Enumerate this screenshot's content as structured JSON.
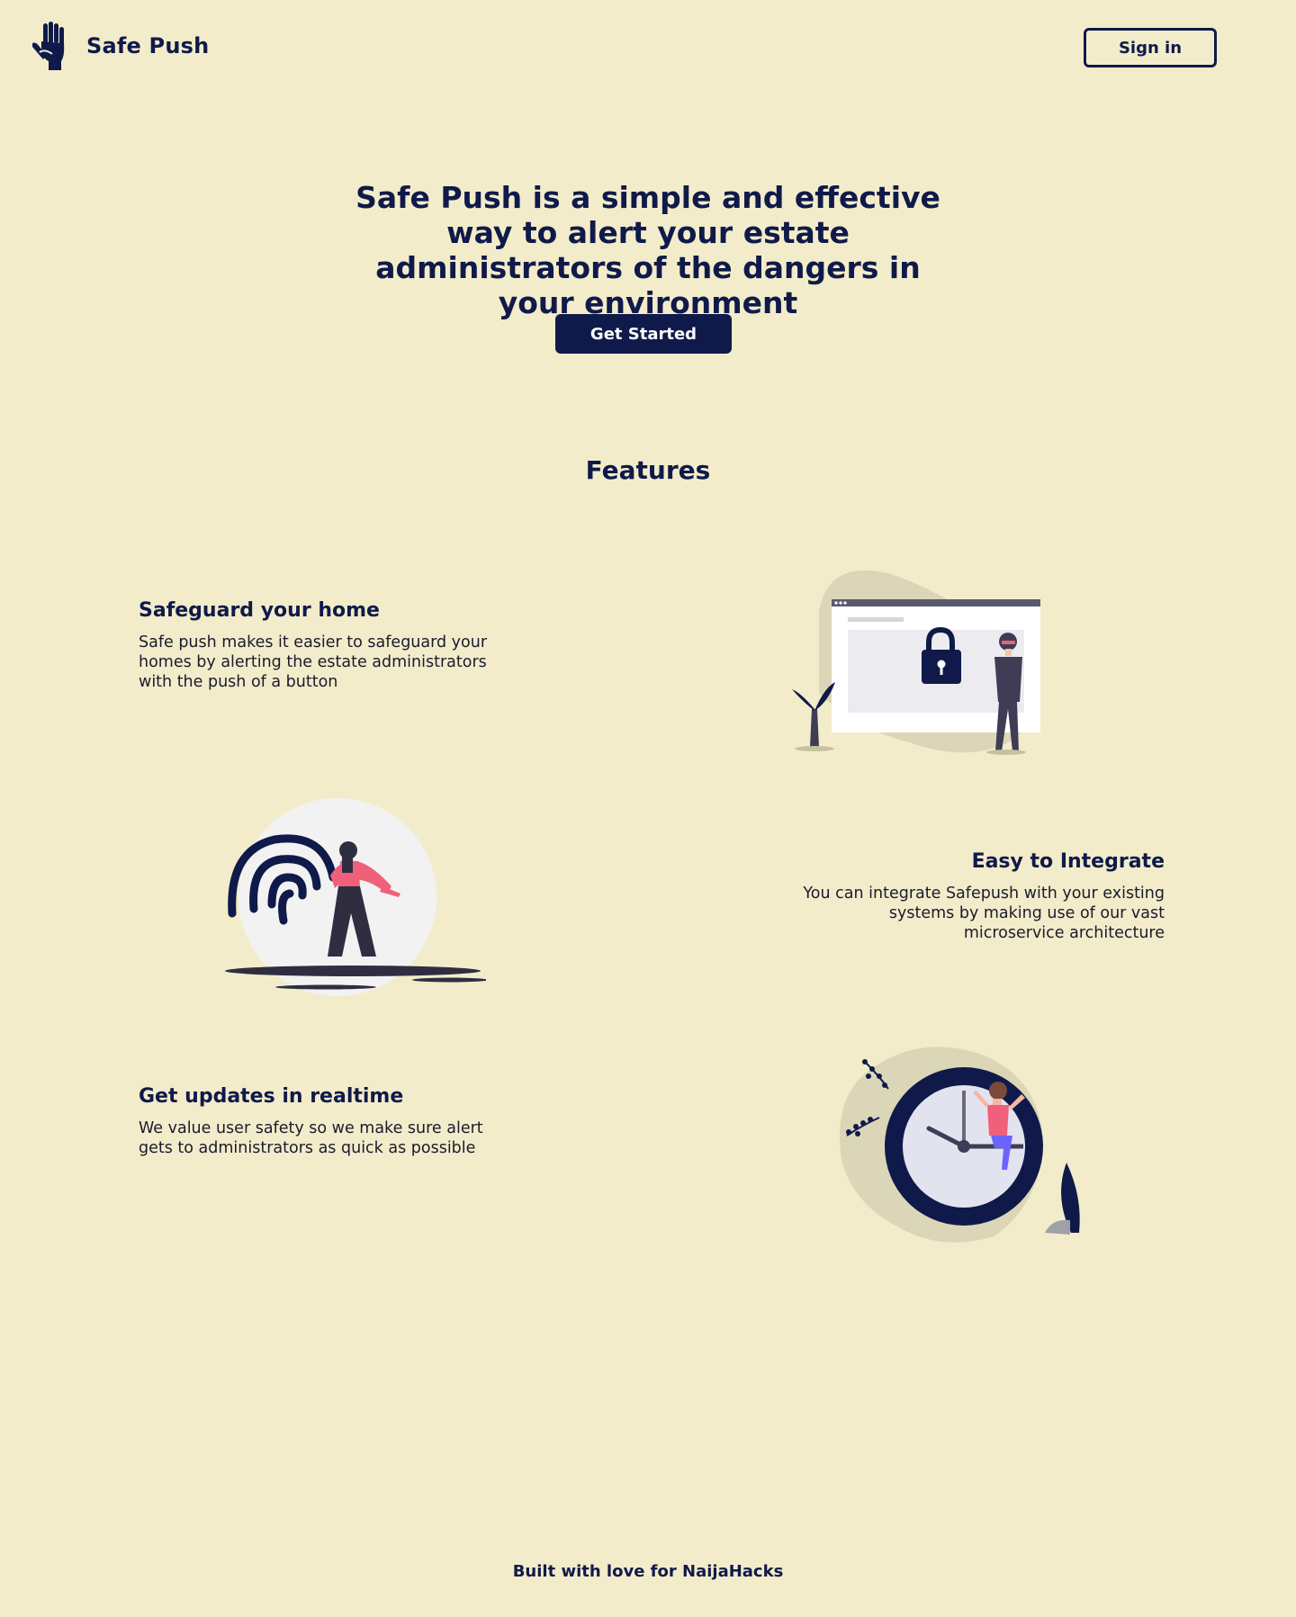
{
  "header": {
    "brand_name": "Safe Push",
    "signin_label": "Sign in"
  },
  "hero": {
    "title": "Safe Push is a simple and effective way to alert your estate administrators of the dangers in your environment",
    "cta_label": "Get Started"
  },
  "features": {
    "title": "Features",
    "items": [
      {
        "title": "Safeguard your home",
        "description": "Safe push makes it easier to safeguard your homes by alerting the estate administrators with the push of a button"
      },
      {
        "title": "Easy to Integrate",
        "description": "You can integrate Safepush with your existing systems by making use of our vast microservice architecture"
      },
      {
        "title": "Get updates in realtime",
        "description": "We value user safety so we make sure alert gets to administrators as quick as possible"
      }
    ]
  },
  "footer": {
    "text": "Built with  love for NaijaHacks"
  },
  "colors": {
    "background": "#f3ecca",
    "navy": "#0f1a4a",
    "accent_pink": "#f0607a"
  },
  "icons": [
    "hand-logo-icon",
    "security-lock-illustration",
    "fingerprint-illustration",
    "clock-illustration"
  ]
}
